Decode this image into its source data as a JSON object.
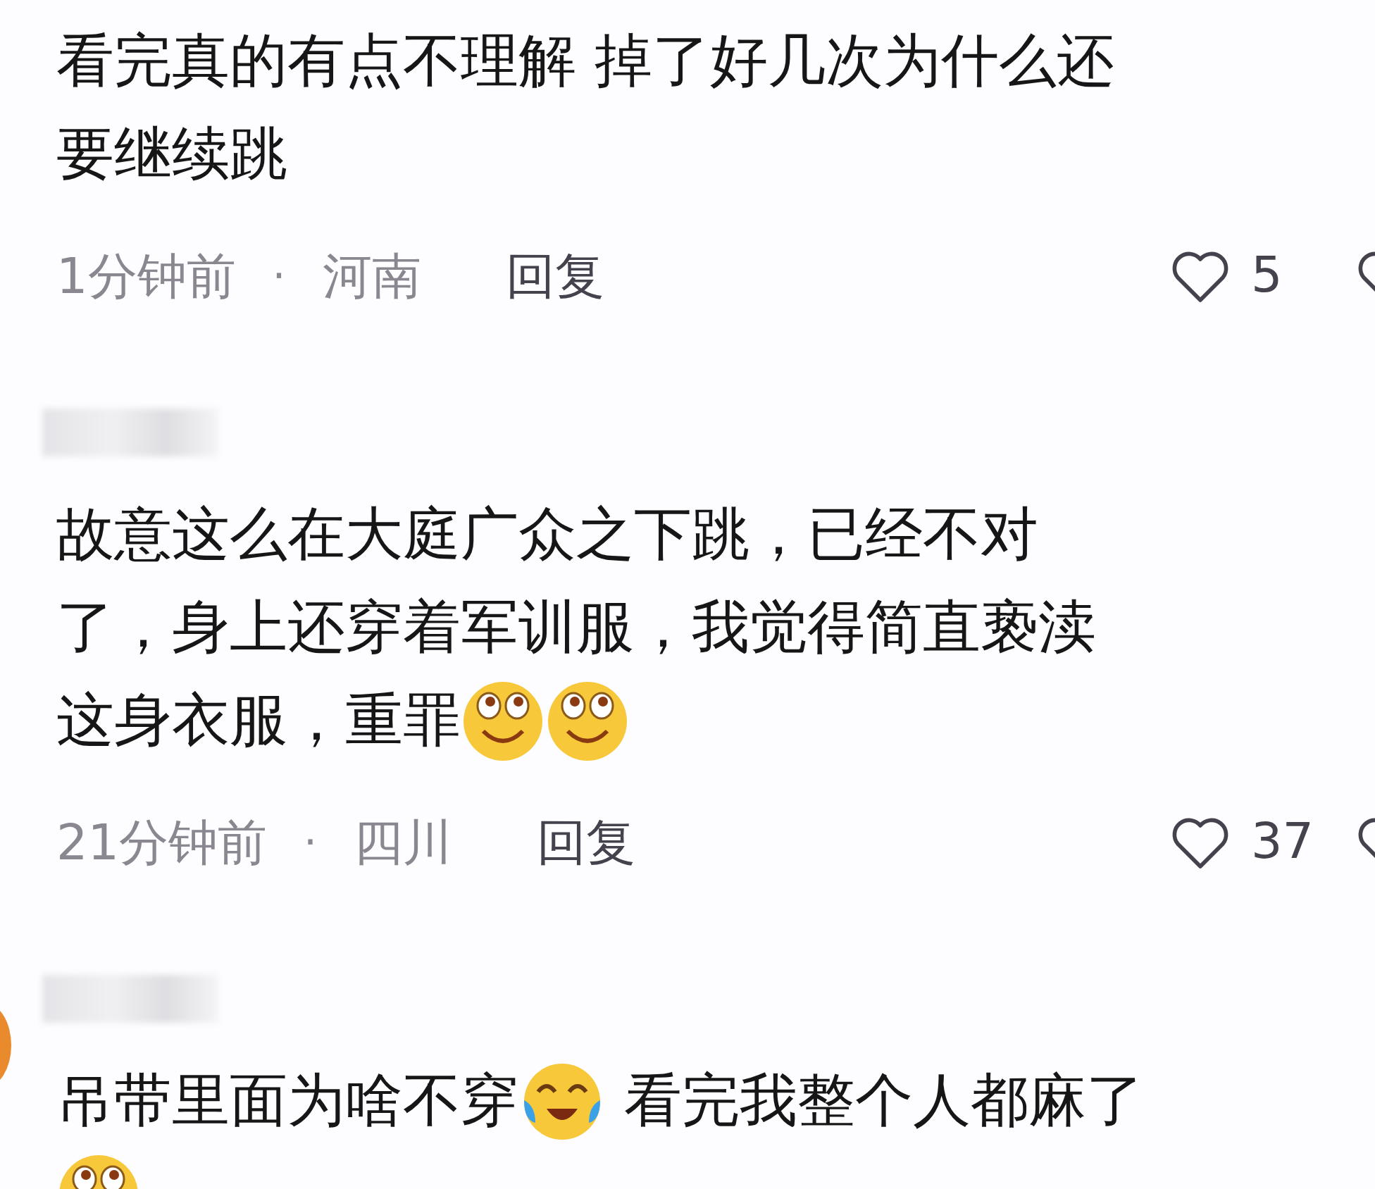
{
  "comments": [
    {
      "username_blurred": false,
      "avatar": false,
      "lines": [
        [
          {
            "kind": "text",
            "text": "看完真的有点不理解 掉了好几次为什么还"
          }
        ],
        [
          {
            "kind": "text",
            "text": "要继续跳"
          }
        ]
      ],
      "time": "1分钟前",
      "separator": "·",
      "location": "河南",
      "reply": "回复",
      "likes": "5"
    },
    {
      "username_blurred": true,
      "avatar": false,
      "lines": [
        [
          {
            "kind": "text",
            "text": "故意这么在大庭广众之下跳，已经不对"
          }
        ],
        [
          {
            "kind": "text",
            "text": "了，身上还穿着军训服，我觉得简直亵渎"
          }
        ],
        [
          {
            "kind": "text",
            "text": "这身衣服，重罪"
          },
          {
            "kind": "grin"
          },
          {
            "kind": "grin"
          }
        ]
      ],
      "time": "21分钟前",
      "separator": "·",
      "location": "四川",
      "reply": "回复",
      "likes": "37"
    },
    {
      "username_blurred": true,
      "avatar": true,
      "lines": [
        [
          {
            "kind": "text",
            "text": "吊带里面为啥不穿"
          },
          {
            "kind": "tearjoy"
          },
          {
            "kind": "text",
            "text": " 看完我整个人都麻了"
          }
        ],
        [
          {
            "kind": "grin"
          }
        ]
      ]
    }
  ]
}
